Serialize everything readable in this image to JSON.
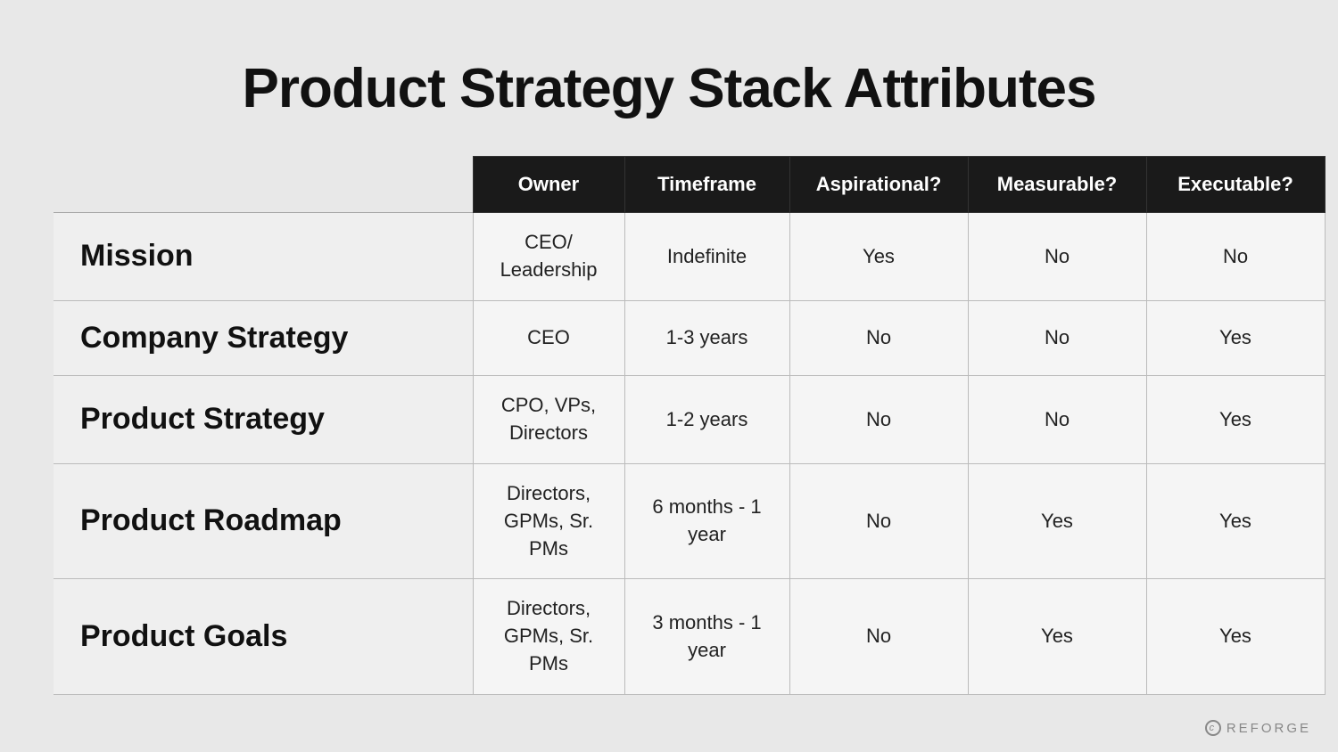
{
  "title": "Product Strategy Stack Attributes",
  "watermark": "REFORGE",
  "headers": {
    "row_label": "",
    "owner": "Owner",
    "timeframe": "Timeframe",
    "aspirational": "Aspirational?",
    "measurable": "Measurable?",
    "executable": "Executable?"
  },
  "rows": [
    {
      "label": "Mission",
      "owner": "CEO/ Leadership",
      "timeframe": "Indefinite",
      "aspirational": "Yes",
      "measurable": "No",
      "executable": "No"
    },
    {
      "label": "Company Strategy",
      "owner": "CEO",
      "timeframe": "1-3 years",
      "aspirational": "No",
      "measurable": "No",
      "executable": "Yes"
    },
    {
      "label": "Product Strategy",
      "owner": "CPO, VPs, Directors",
      "timeframe": "1-2 years",
      "aspirational": "No",
      "measurable": "No",
      "executable": "Yes"
    },
    {
      "label": "Product Roadmap",
      "owner": "Directors, GPMs, Sr. PMs",
      "timeframe": "6 months - 1 year",
      "aspirational": "No",
      "measurable": "Yes",
      "executable": "Yes"
    },
    {
      "label": "Product Goals",
      "owner": "Directors, GPMs, Sr. PMs",
      "timeframe": "3 months - 1 year",
      "aspirational": "No",
      "measurable": "Yes",
      "executable": "Yes"
    }
  ]
}
